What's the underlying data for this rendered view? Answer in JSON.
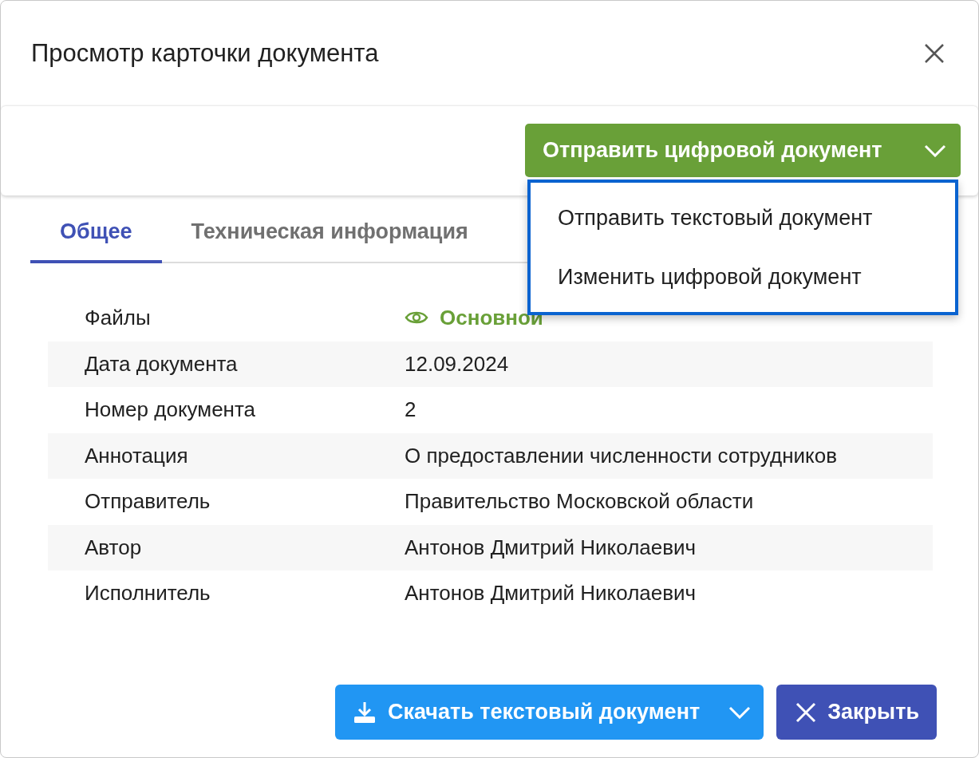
{
  "dialog": {
    "title": "Просмотр карточки документа"
  },
  "toolbar": {
    "send_button": "Отправить цифровой документ",
    "menu": [
      "Отправить текстовый документ",
      "Изменить цифровой документ"
    ]
  },
  "tabs": [
    {
      "label": "Общее",
      "selected": true
    },
    {
      "label": "Техническая информация",
      "selected": false
    }
  ],
  "fields": [
    {
      "label": "Файлы",
      "value": "Основной",
      "kind": "link"
    },
    {
      "label": "Дата документа",
      "value": "12.09.2024",
      "kind": "text"
    },
    {
      "label": "Номер документа",
      "value": "2",
      "kind": "text"
    },
    {
      "label": "Аннотация",
      "value": "О предоставлении численности сотрудников",
      "kind": "text"
    },
    {
      "label": "Отправитель",
      "value": "Правительство Московской области",
      "kind": "text"
    },
    {
      "label": "Автор",
      "value": "Антонов Дмитрий Николаевич",
      "kind": "text"
    },
    {
      "label": "Исполнитель",
      "value": "Антонов Дмитрий Николаевич",
      "kind": "text"
    }
  ],
  "footer": {
    "download_button": "Скачать текстовый документ",
    "close_button": "Закрыть"
  }
}
